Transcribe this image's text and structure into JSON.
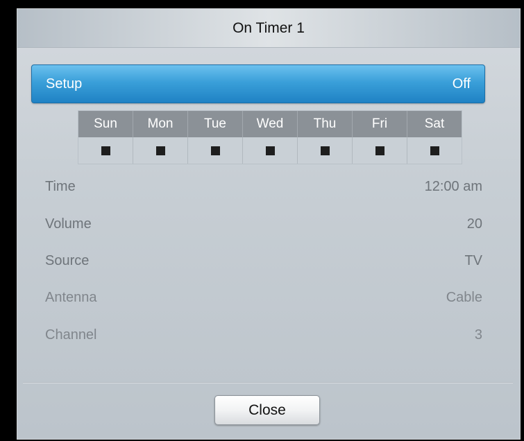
{
  "dialog": {
    "title": "On Timer 1"
  },
  "setup": {
    "label": "Setup",
    "value": "Off"
  },
  "days": [
    {
      "label": "Sun",
      "checked": false
    },
    {
      "label": "Mon",
      "checked": false
    },
    {
      "label": "Tue",
      "checked": false
    },
    {
      "label": "Wed",
      "checked": false
    },
    {
      "label": "Thu",
      "checked": false
    },
    {
      "label": "Fri",
      "checked": false
    },
    {
      "label": "Sat",
      "checked": false
    }
  ],
  "fields": {
    "time": {
      "label": "Time",
      "value": "12:00 am"
    },
    "volume": {
      "label": "Volume",
      "value": "20"
    },
    "source": {
      "label": "Source",
      "value": "TV"
    },
    "antenna": {
      "label": "Antenna",
      "value": "Cable"
    },
    "channel": {
      "label": "Channel",
      "value": "3"
    }
  },
  "buttons": {
    "close_label": "Close"
  },
  "colors": {
    "highlight": "#2a8fd0",
    "text_dim": "#6e747a",
    "day_header_bg": "#8b9197"
  }
}
